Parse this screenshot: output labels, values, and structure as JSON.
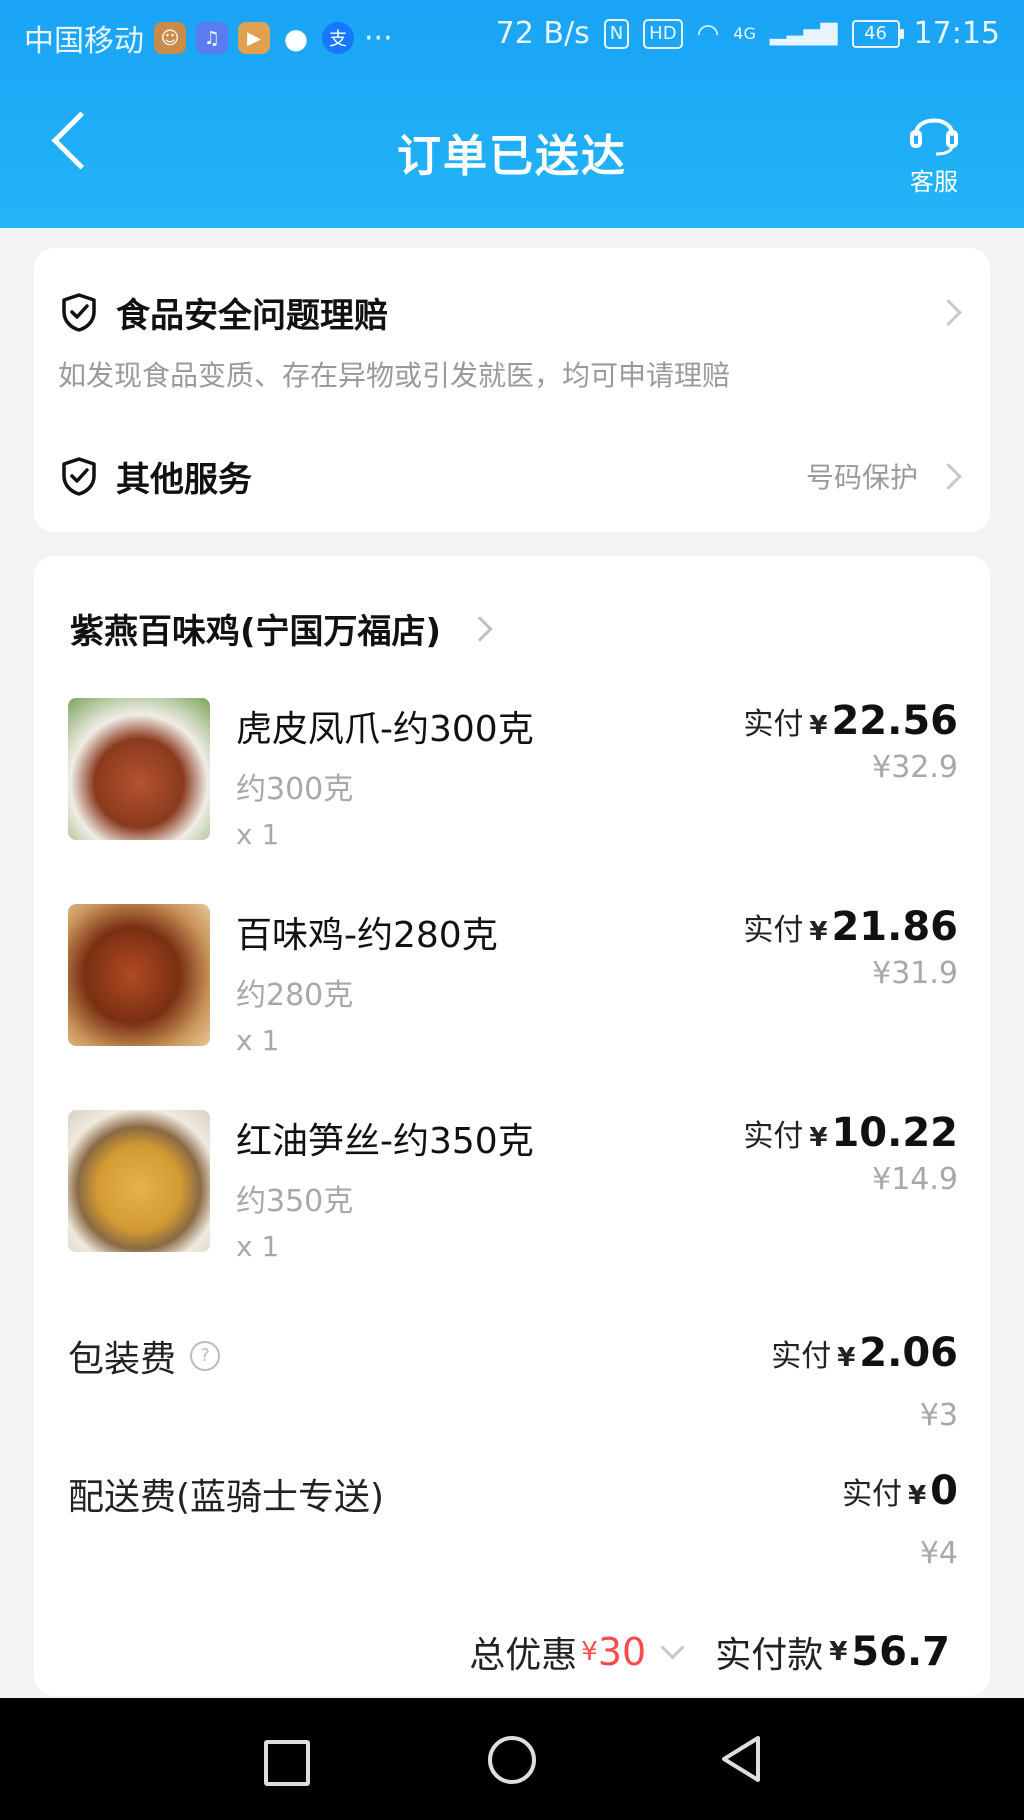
{
  "status_bar": {
    "carrier": "中国移动",
    "net_speed": "72 B/s",
    "nfc": "N",
    "hd": "HD",
    "net_type": "4G",
    "battery": "46",
    "time": "17:15"
  },
  "header": {
    "title": "订单已送达",
    "service_label": "客服"
  },
  "services": {
    "food_safety_title": "食品安全问题理赔",
    "food_safety_desc": "如发现食品变质、存在异物或引发就医，均可申请理赔",
    "other_title": "其他服务",
    "other_value": "号码保护"
  },
  "order": {
    "shop_name": "紫燕百味鸡(宁国万福店)",
    "paid_label": "实付",
    "currency": "¥",
    "items": [
      {
        "name": "虎皮凤爪-约300克",
        "spec": "约300克",
        "qty": "x 1",
        "paid": "22.56",
        "original": "¥32.9",
        "thumb_color": "#b5532f"
      },
      {
        "name": "百味鸡-约280克",
        "spec": "约280克",
        "qty": "x 1",
        "paid": "21.86",
        "original": "¥31.9",
        "thumb_color": "#9a3f1d"
      },
      {
        "name": "红油笋丝-约350克",
        "spec": "约350克",
        "qty": "x 1",
        "paid": "10.22",
        "original": "¥14.9",
        "thumb_color": "#d9a441"
      }
    ],
    "packing_fee": {
      "label": "包装费",
      "help": "?",
      "paid": "2.06",
      "original": "¥3"
    },
    "delivery_fee": {
      "label": "配送费(蓝骑士专送)",
      "paid": "0",
      "original": "¥4"
    },
    "total": {
      "discount_label": "总优惠",
      "discount_value": "30",
      "paid_label": "实付款",
      "paid_value": "56.7"
    }
  },
  "colors": {
    "header_blue": "#1aa3f5",
    "discount_red": "#ff4a4a"
  }
}
